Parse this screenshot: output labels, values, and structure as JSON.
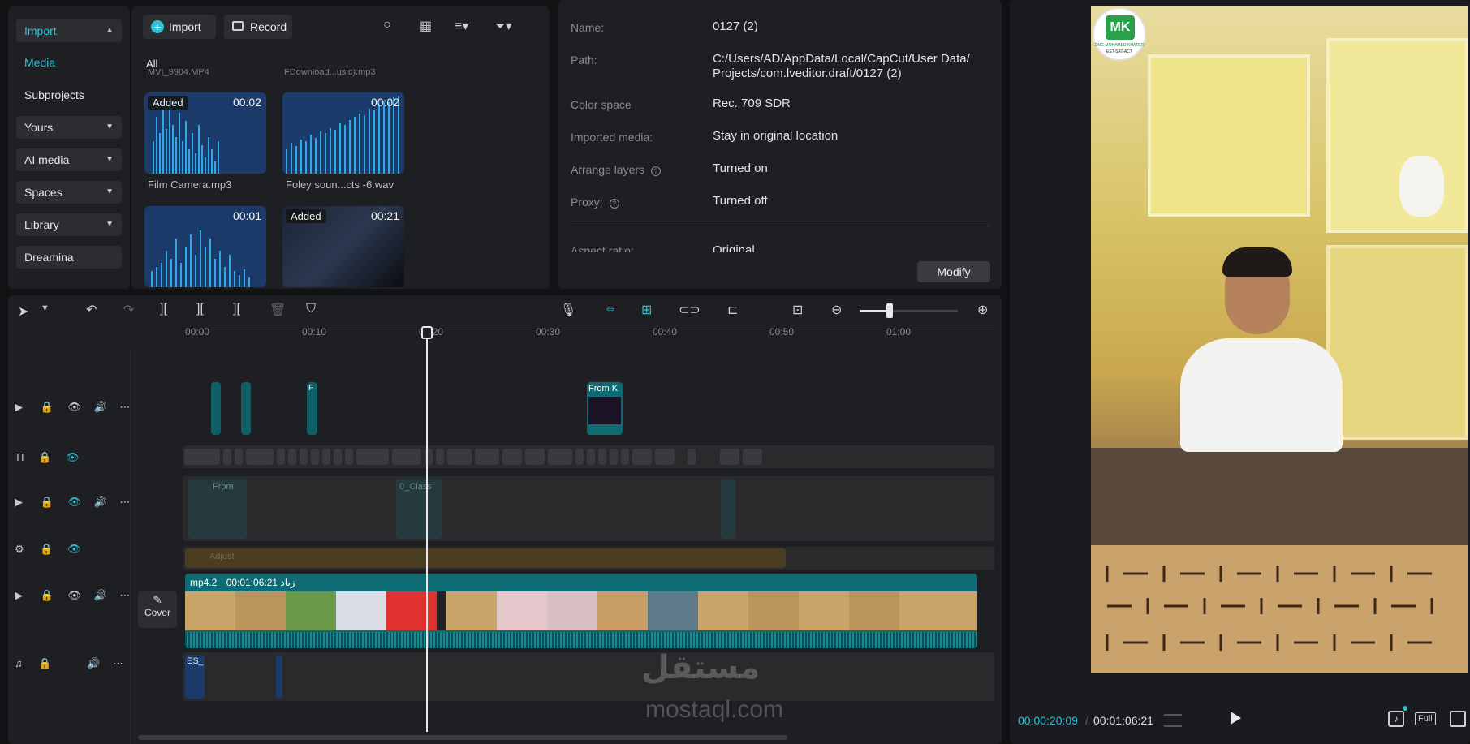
{
  "nav": {
    "import": "Import",
    "media": "Media",
    "subprojects": "Subprojects",
    "yours": "Yours",
    "ai_media": "AI media",
    "spaces": "Spaces",
    "library": "Library",
    "dreamina": "Dreamina"
  },
  "media": {
    "import_btn": "Import",
    "record_btn": "Record",
    "filter_all": "All",
    "cut_label_1": "MVI_9904.MP4",
    "cut_label_2": "FDownload...usic).mp3",
    "items": [
      {
        "name": "Film Camera.mp3",
        "badge": "Added",
        "duration": "00:02"
      },
      {
        "name": "Foley soun...cts -6.wav",
        "badge": "",
        "duration": "00:02"
      },
      {
        "name": "",
        "badge": "",
        "duration": "00:01"
      },
      {
        "name": "",
        "badge": "Added",
        "duration": "00:21"
      }
    ]
  },
  "props": {
    "name_label": "Name:",
    "name_value": "0127 (2)",
    "path_label": "Path:",
    "path_value_1": "C:/Users/AD/AppData/Local/CapCut/User Data/",
    "path_value_2": "Projects/com.lveditor.draft/0127 (2)",
    "color_label": "Color space",
    "color_value": "Rec. 709 SDR",
    "imported_label": "Imported media:",
    "imported_value": "Stay in original location",
    "arrange_label": "Arrange layers",
    "arrange_value": "Turned on",
    "proxy_label": "Proxy:",
    "proxy_value": "Turned off",
    "aspect_label": "Aspect ratio:",
    "aspect_value": "Original",
    "modify_btn": "Modify"
  },
  "timeline": {
    "ruler": [
      "00:00",
      "00:10",
      "00:20",
      "00:30",
      "00:40",
      "00:50",
      "01:00"
    ],
    "clip_from_k": "From K",
    "clip_f": "F",
    "clip_from2": "From",
    "clip_class": "0_Class",
    "adjust_label": "Adjust",
    "main_clip_name": "mp4.2 زياد",
    "main_clip_duration": "00:01:06:21",
    "cover_label": "Cover",
    "audio_label": "ES_"
  },
  "player": {
    "current_time": "00:00:20:09",
    "total_time": "00:01:06:21",
    "full_label": "Full",
    "logo_sub": "ENG-MOHAMED KHATER",
    "logo_tag": "EST-SAT-ACT"
  },
  "watermark": {
    "arabic": "مستقل",
    "latin": "mostaql.com"
  },
  "colors": {
    "accent": "#2fc0d6",
    "panel": "#1e1f22",
    "clip_teal": "#1a7f86"
  }
}
